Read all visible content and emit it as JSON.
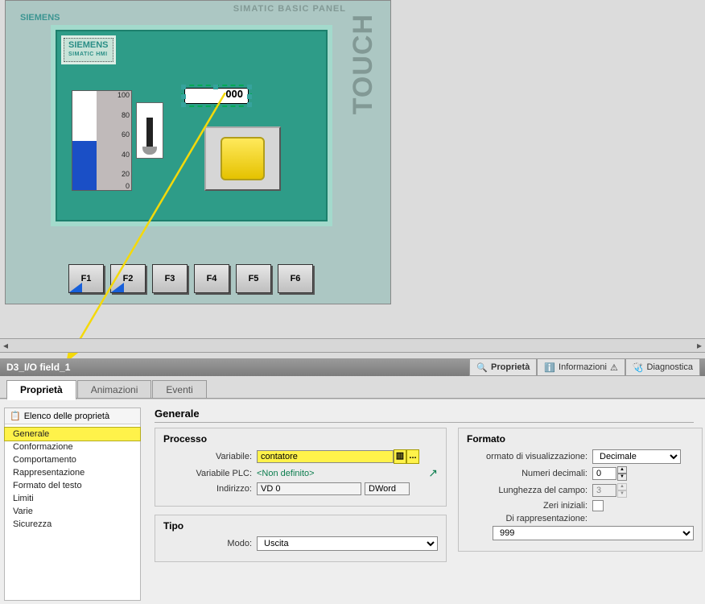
{
  "panel": {
    "title": "SIMATIC BASIC PANEL",
    "touch": "TOUCH",
    "brand": "SIEMENS",
    "badge_top": "SIEMENS",
    "badge_bottom": "SIMATIC HMI",
    "io_value": "OOO",
    "gauge_ticks": [
      "100",
      "80",
      "60",
      "40",
      "20",
      "0"
    ],
    "fkeys": [
      "F1",
      "F2",
      "F3",
      "F4",
      "F5",
      "F6"
    ]
  },
  "inspector": {
    "object_name": "D3_I/O field_1",
    "right_tabs": {
      "properties": "Proprietà",
      "info": "Informazioni",
      "diag": "Diagnostica"
    },
    "subtabs": {
      "p": "Proprietà",
      "a": "Animazioni",
      "e": "Eventi"
    },
    "tree_header": "Elenco delle proprietà",
    "tree": [
      "Generale",
      "Conformazione",
      "Comportamento",
      "Rappresentazione",
      "Formato del testo",
      "Limiti",
      "Varie",
      "Sicurezza"
    ],
    "heading": "Generale",
    "processo": {
      "title": "Processo",
      "variabile_lbl": "Variabile:",
      "variabile_val": "contatore",
      "variabile_plc_lbl": "Variabile PLC:",
      "variabile_plc_val": "<Non definito>",
      "indirizzo_lbl": "Indirizzo:",
      "indirizzo_val": "VD 0",
      "indirizzo_type": "DWord"
    },
    "tipo": {
      "title": "Tipo",
      "modo_lbl": "Modo:",
      "modo_val": "Uscita"
    },
    "formato": {
      "title": "Formato",
      "vis_lbl": "ormato di visualizzazione:",
      "vis_val": "Decimale",
      "dec_lbl": "Numeri decimali:",
      "dec_val": "0",
      "len_lbl": "Lunghezza del campo:",
      "len_val": "3",
      "zeri_lbl": "Zeri iniziali:",
      "rep_lbl": "Di rappresentazione:",
      "rep_val": "999"
    }
  }
}
